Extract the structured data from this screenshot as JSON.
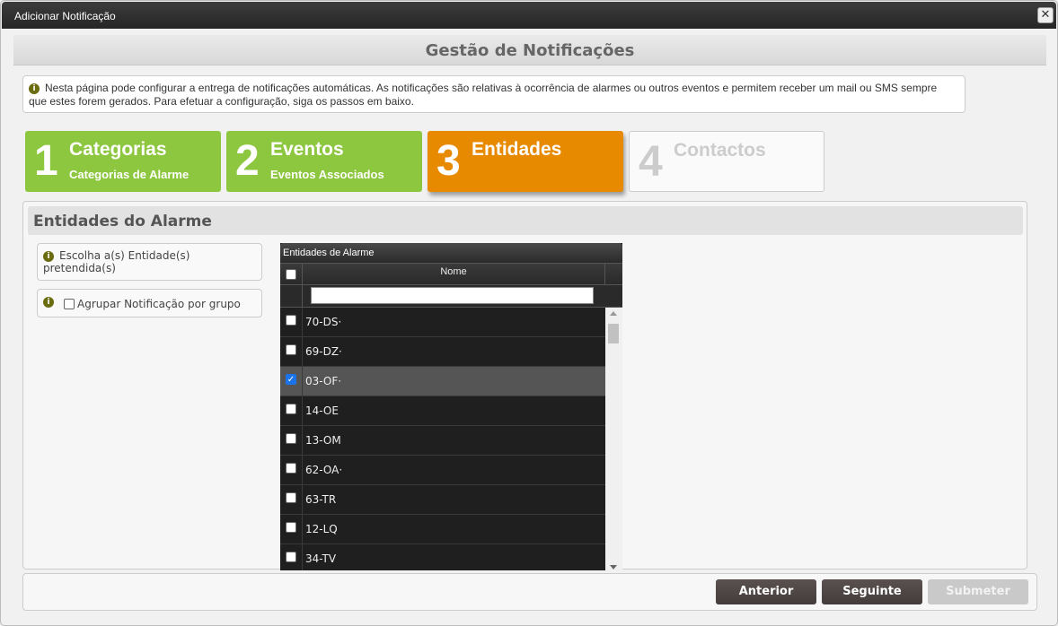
{
  "window": {
    "title": "Adicionar Notificação",
    "close_icon": "close-icon"
  },
  "header": {
    "title": "Gestão de Notificações"
  },
  "info": {
    "text": "Nesta página pode configurar a entrega de notificações automáticas. As notificações são relativas à ocorrência de alarmes ou outros eventos e permitem receber um mail ou SMS sempre que estes forem gerados. Para efetuar a configuração, siga os passos em baixo."
  },
  "steps": [
    {
      "num": "1",
      "label": "Categorias",
      "sub": "Categorias de Alarme",
      "state": "done",
      "color": "#8dc63f"
    },
    {
      "num": "2",
      "label": "Eventos",
      "sub": "Eventos Associados",
      "state": "done",
      "color": "#8dc63f"
    },
    {
      "num": "3",
      "label": "Entidades",
      "sub": "",
      "state": "active",
      "color": "#e78a00"
    },
    {
      "num": "4",
      "label": "Contactos",
      "sub": "",
      "state": "todo",
      "color": "#cccccc"
    }
  ],
  "panel": {
    "title": "Entidades do Alarme",
    "choose_hint": "Escolha a(s) Entidade(s) pretendida(s)",
    "group_label": "Agrupar Notificação por grupo"
  },
  "grid": {
    "title": "Entidades de Alarme",
    "column_name": "Nome",
    "filter_value": "",
    "rows": [
      {
        "name": "70-DS·",
        "checked": false
      },
      {
        "name": "69-DZ·",
        "checked": false
      },
      {
        "name": "03-OF·",
        "checked": true
      },
      {
        "name": "14-OE",
        "checked": false
      },
      {
        "name": "13-OM",
        "checked": false
      },
      {
        "name": "62-OA·",
        "checked": false
      },
      {
        "name": " 63-TR",
        "checked": false
      },
      {
        "name": "12-LQ",
        "checked": false
      },
      {
        "name": "34-TV",
        "checked": false
      }
    ]
  },
  "footer": {
    "prev_label": "Anterior",
    "next_label": "Seguinte",
    "submit_label": "Submeter"
  }
}
